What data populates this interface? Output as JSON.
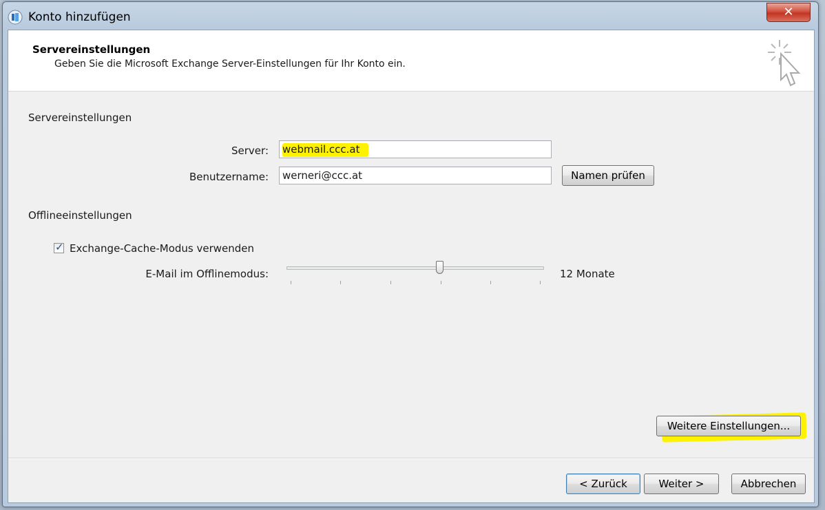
{
  "dialog": {
    "title": "Konto hinzufügen",
    "close_label": "✕"
  },
  "header": {
    "title": "Servereinstellungen",
    "subtitle": "Geben Sie die Microsoft Exchange Server-Einstellungen für Ihr Konto ein."
  },
  "server_section": {
    "label": "Servereinstellungen",
    "server_label": "Server:",
    "server_value": "webmail.ccc.at",
    "username_label": "Benutzername:",
    "username_value": "werneri@ccc.at",
    "check_names_button": "Namen prüfen"
  },
  "offline_section": {
    "label": "Offlineeinstellungen",
    "cache_mode_label": "Exchange-Cache-Modus verwenden",
    "cache_mode_checked": true,
    "offline_mail_label": "E-Mail im Offlinemodus:",
    "offline_mail_value": "12 Monate",
    "slider_position": 0.6
  },
  "more_settings_button": "Weitere Einstellungen...",
  "footer": {
    "back_button": "< Zurück",
    "next_button": "Weiter >",
    "cancel_button": "Abbrechen"
  },
  "colors": {
    "highlight": "#fff200",
    "close": "#c33423",
    "client_bg": "#f0f0f0"
  }
}
